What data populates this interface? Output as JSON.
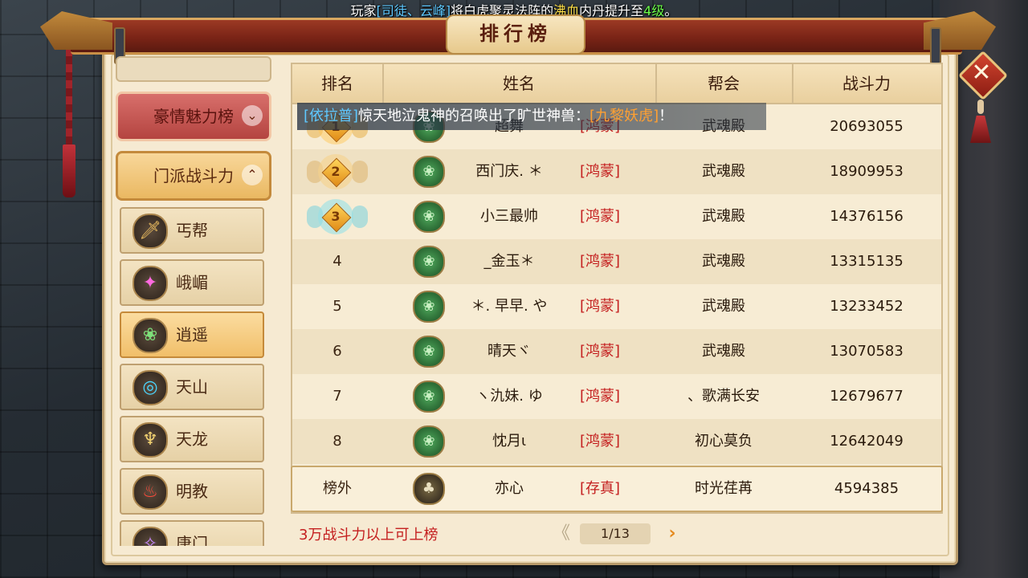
{
  "broadcast_top": {
    "prefix": "玩家",
    "player": "[司徒、云峰]",
    "mid": "将白虎聚灵法阵的",
    "item": "沸血",
    "mid2": "内丹提升至",
    "level": "4级",
    "suffix": "。"
  },
  "panel": {
    "title": "排行榜"
  },
  "close_icon": "✕",
  "sidebar": {
    "categories": [
      {
        "label": "豪情魅力榜",
        "arrow": "⌄"
      },
      {
        "label": "门派战斗力",
        "arrow": "⌃"
      }
    ],
    "sects": [
      {
        "label": "丐帮",
        "icon": "🗡"
      },
      {
        "label": "峨嵋",
        "icon": "✦"
      },
      {
        "label": "逍遥",
        "icon": "❀"
      },
      {
        "label": "天山",
        "icon": "◎"
      },
      {
        "label": "天龙",
        "icon": "♆"
      },
      {
        "label": "明教",
        "icon": "♨"
      },
      {
        "label": "唐门",
        "icon": "✧"
      }
    ]
  },
  "table": {
    "headers": [
      "排名",
      "姓名",
      "帮会",
      "战斗力"
    ],
    "rows": [
      {
        "rank": "1",
        "name": "超舞",
        "tag": "[鸿蒙]",
        "guild": "武魂殿",
        "power": "20693055"
      },
      {
        "rank": "2",
        "name": "西门庆. ＊",
        "tag": "[鸿蒙]",
        "guild": "武魂殿",
        "power": "18909953"
      },
      {
        "rank": "3",
        "name": "小三最帅",
        "tag": "[鸿蒙]",
        "guild": "武魂殿",
        "power": "14376156"
      },
      {
        "rank": "4",
        "name": "_金玉＊",
        "tag": "[鸿蒙]",
        "guild": "武魂殿",
        "power": "13315135"
      },
      {
        "rank": "5",
        "name": "＊. 早早. や",
        "tag": "[鸿蒙]",
        "guild": "武魂殿",
        "power": "13233452"
      },
      {
        "rank": "6",
        "name": "晴天ヾ",
        "tag": "[鸿蒙]",
        "guild": "武魂殿",
        "power": "13070583"
      },
      {
        "rank": "7",
        "name": "ヽ氿妹. ゆ",
        "tag": "[鸿蒙]",
        "guild": "、歌满长安",
        "power": "12679677"
      },
      {
        "rank": "8",
        "name": "忱月ι",
        "tag": "[鸿蒙]",
        "guild": "初心莫负",
        "power": "12642049"
      }
    ],
    "self": {
      "rank": "榜外",
      "name": "亦心",
      "tag": "[存真]",
      "guild": "时光荏苒",
      "power": "4594385"
    }
  },
  "broadcast_mid": {
    "tag": "[依拉普]",
    "text": "惊天地泣鬼神的召唤出了旷世神兽：",
    "beast": "[九黎妖虎]",
    "end": "！"
  },
  "footer": {
    "note": "3万战斗力以上可上榜",
    "page": "1/13",
    "prev": "《",
    "next": "›"
  },
  "colors": {
    "accent_red": "#c41f1f",
    "panel_bg": "#f6ead2",
    "beam": "#7a2416"
  }
}
